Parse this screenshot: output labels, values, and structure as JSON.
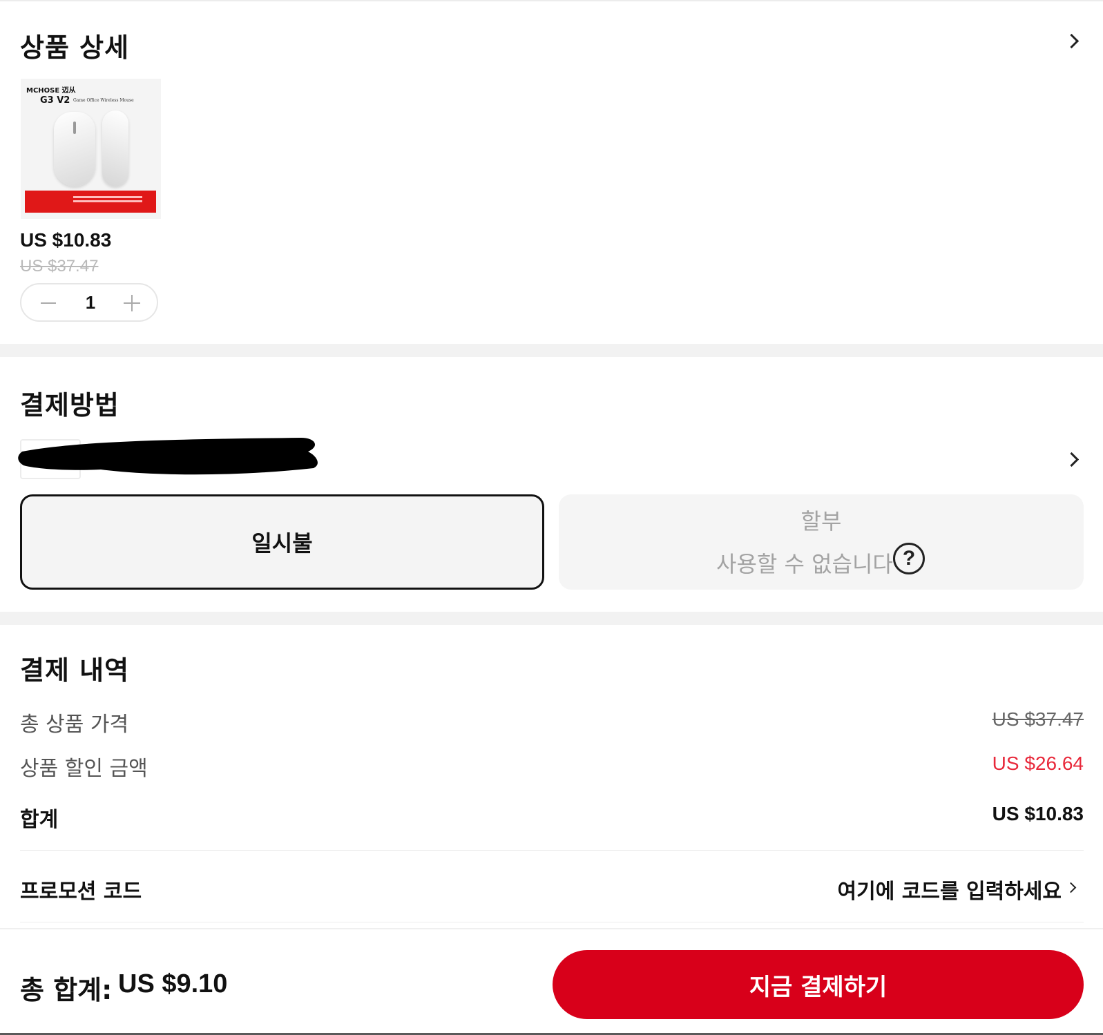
{
  "product_section": {
    "title": "상품 상세",
    "image": {
      "brand": "MCHOSE 迈从",
      "model": "G3 V2",
      "subtitle": "Game Office Wireless Mouse"
    },
    "price": "US $10.83",
    "original_price": "US $37.47",
    "quantity": "1"
  },
  "payment_section": {
    "title": "결제방법",
    "options": {
      "lump_sum": "일시불",
      "installment_title": "할부",
      "installment_status": "사용할 수 없습니다"
    }
  },
  "summary_section": {
    "title": "결제 내역",
    "rows": [
      {
        "label": "총 상품 가격",
        "value": "US $37.47"
      },
      {
        "label": "상품 할인 금액",
        "value": "US $26.64"
      },
      {
        "label": "합계",
        "value": "US $10.83"
      }
    ],
    "promo": {
      "label": "프로모션 코드",
      "action": "여기에 코드를 입력하세요"
    }
  },
  "footer": {
    "total_label": "총 합계:",
    "total_value": "US $9.10",
    "pay_button": "지금 결제하기"
  },
  "colors": {
    "accent_red": "#d8001a",
    "discount_red": "#e8283a"
  }
}
